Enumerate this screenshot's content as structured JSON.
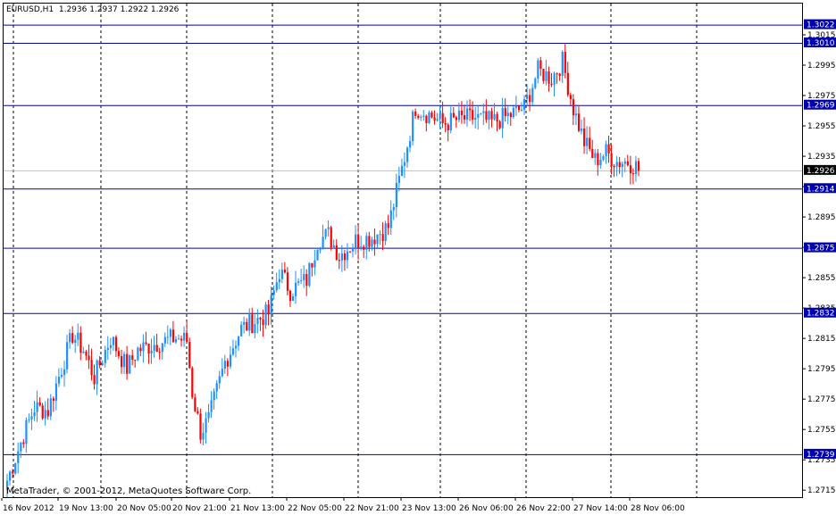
{
  "header": {
    "symbol": "EURUSD,H1",
    "ohlc": "1.2936 1.2937 1.2922 1.2926"
  },
  "footer": {
    "copyright": "MetaTrader, © 2001-2012, MetaQuotes Software Corp."
  },
  "colors": {
    "bull": "#1e90ff",
    "bear": "#ff0000",
    "level_line": "#0000b0",
    "level_tag": "#0000b0",
    "current_tag": "#000000",
    "grid": "#000000",
    "bid_line": "#c0c0c0"
  },
  "chart_data": {
    "type": "candlestick",
    "symbol": "EURUSD",
    "timeframe": "H1",
    "ylim": [
      1.2711,
      1.3035
    ],
    "grid": "vertical-dashed",
    "time_labels": [
      "16 Nov 2012",
      "19 Nov 13:00",
      "20 Nov 05:00",
      "20 Nov 21:00",
      "21 Nov 13:00",
      "22 Nov 05:00",
      "22 Nov 21:00",
      "23 Nov 13:00",
      "26 Nov 06:00",
      "26 Nov 22:00",
      "27 Nov 14:00",
      "28 Nov 06:00"
    ],
    "price_ticks": [
      "1.3015",
      "1.2995",
      "1.2975",
      "1.2955",
      "1.2935",
      "1.2915",
      "1.2895",
      "1.2875",
      "1.2855",
      "1.2835",
      "1.2815",
      "1.2795",
      "1.2775",
      "1.2755",
      "1.2735",
      "1.2715"
    ],
    "price_tick_values": [
      1.3015,
      1.2995,
      1.2975,
      1.2955,
      1.2935,
      1.2915,
      1.2895,
      1.2875,
      1.2855,
      1.2835,
      1.2815,
      1.2795,
      1.2775,
      1.2755,
      1.2735,
      1.2715
    ],
    "levels": [
      {
        "price": 1.3022,
        "label": "1.3022"
      },
      {
        "price": 1.301,
        "label": "1.3010"
      },
      {
        "price": 1.2969,
        "label": "1.2969"
      },
      {
        "price": 1.2914,
        "label": "1.2914"
      },
      {
        "price": 1.2875,
        "label": "1.2875"
      },
      {
        "price": 1.2832,
        "label": "1.2832"
      },
      {
        "price": 1.2739,
        "label": "1.2739"
      }
    ],
    "current_price": {
      "price": 1.2926,
      "label": "1.2926"
    },
    "path_anchors": [
      [
        0,
        1.2722
      ],
      [
        6,
        1.2752
      ],
      [
        10,
        1.277
      ],
      [
        15,
        1.2768
      ],
      [
        18,
        1.2785
      ],
      [
        24,
        1.2818
      ],
      [
        28,
        1.2808
      ],
      [
        32,
        1.279
      ],
      [
        38,
        1.2816
      ],
      [
        44,
        1.2796
      ],
      [
        48,
        1.2808
      ],
      [
        54,
        1.2812
      ],
      [
        62,
        1.2816
      ],
      [
        66,
        1.2814
      ],
      [
        68,
        1.278
      ],
      [
        71,
        1.2754
      ],
      [
        74,
        1.2762
      ],
      [
        80,
        1.28
      ],
      [
        86,
        1.2822
      ],
      [
        90,
        1.2826
      ],
      [
        96,
        1.2832
      ],
      [
        100,
        1.286
      ],
      [
        104,
        1.2847
      ],
      [
        110,
        1.2854
      ],
      [
        114,
        1.288
      ],
      [
        118,
        1.2884
      ],
      [
        122,
        1.287
      ],
      [
        128,
        1.288
      ],
      [
        134,
        1.2882
      ],
      [
        140,
        1.2889
      ],
      [
        146,
        1.2935
      ],
      [
        150,
        1.2968
      ],
      [
        156,
        1.2962
      ],
      [
        160,
        1.2957
      ],
      [
        166,
        1.296
      ],
      [
        172,
        1.2961
      ],
      [
        178,
        1.2958
      ],
      [
        184,
        1.2962
      ],
      [
        190,
        1.2968
      ],
      [
        195,
        1.2992
      ],
      [
        200,
        1.2987
      ],
      [
        204,
        1.2998
      ],
      [
        208,
        1.2967
      ],
      [
        212,
        1.2945
      ],
      [
        216,
        1.2933
      ],
      [
        220,
        1.2938
      ],
      [
        224,
        1.2932
      ],
      [
        228,
        1.2932
      ],
      [
        232,
        1.2928
      ]
    ]
  }
}
